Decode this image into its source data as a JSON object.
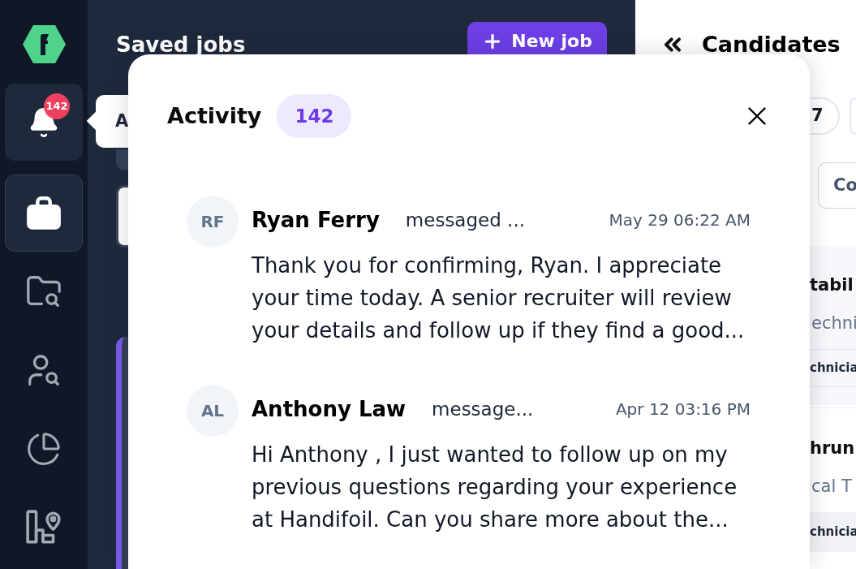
{
  "sidebar": {
    "items": [
      {
        "kind": "notifications",
        "hovered": true,
        "selected": false,
        "badge": "142",
        "tooltip": "A"
      },
      {
        "kind": "jobs",
        "hovered": false,
        "selected": true
      },
      {
        "kind": "folders",
        "hovered": false,
        "selected": false
      },
      {
        "kind": "people",
        "hovered": false,
        "selected": false
      },
      {
        "kind": "reports",
        "hovered": false,
        "selected": false
      },
      {
        "kind": "locations",
        "hovered": false,
        "selected": false
      }
    ]
  },
  "saved_jobs": {
    "title": "Saved jobs",
    "new_job_button": "New job",
    "job_cards": [
      {
        "selected": true
      }
    ]
  },
  "activity": {
    "title": "Activity",
    "count": "142",
    "items": [
      {
        "initials": "RF",
        "name": "Ryan Ferry",
        "action": "messaged ...",
        "time": "May 29 06:22 AM",
        "message": "Thank you for confirming, Ryan. I appreciate your time today. A senior recruiter will review your details and follow up if they find a good..."
      },
      {
        "initials": "AL",
        "name": "Anthony Law",
        "action": "message...",
        "time": "Apr 12 03:16 PM",
        "message": "Hi Anthony , I just wanted to follow up on my previous questions regarding your experience at Handifoil. Can you share more about the..."
      }
    ]
  },
  "candidates": {
    "title": "Candidates",
    "chips": [
      {
        "kind": "count",
        "label": "7"
      },
      {
        "kind": "blank"
      }
    ],
    "button": "Co",
    "cards": [
      {
        "title": "tabil",
        "subtitle": "echni",
        "tag": "chnicia",
        "selected": true
      },
      {
        "title": "hrun",
        "subtitle": "cal T",
        "tag": "chnicia",
        "selected": false
      }
    ]
  }
}
